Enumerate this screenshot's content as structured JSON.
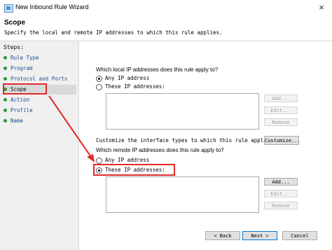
{
  "window": {
    "title": "New Inbound Rule Wizard",
    "close_glyph": "×"
  },
  "header": {
    "title": "Scope",
    "subtitle": "Specify the local and remote IP addresses to which this rule applies."
  },
  "steps": {
    "title": "Steps:",
    "items": [
      {
        "label": "Rule Type"
      },
      {
        "label": "Program"
      },
      {
        "label": "Protocol and Ports"
      },
      {
        "label": "Scope"
      },
      {
        "label": "Action"
      },
      {
        "label": "Profile"
      },
      {
        "label": "Name"
      }
    ],
    "active_index": 3
  },
  "local": {
    "question": "Which local IP addresses does this rule apply to?",
    "any_label": "Any IP address",
    "these_label": "These IP addresses:",
    "selected": "any",
    "add": "Add...",
    "edit": "Edit...",
    "remove": "Remove"
  },
  "customize": {
    "text": "Customize the interface types to which this rule applies:",
    "button": "Customize..."
  },
  "remote": {
    "question": "Which remote IP addresses does this rule apply to?",
    "any_label": "Any IP address",
    "these_label": "These IP addresses:",
    "selected": "these",
    "add": "Add...",
    "edit": "Edit...",
    "remove": "Remove"
  },
  "footer": {
    "back": "< Back",
    "next": "Next >",
    "cancel": "Cancel"
  },
  "colors": {
    "highlight": "#e02a2a",
    "step_dot": "#2e9b2e",
    "step_link": "#1a4f8f"
  }
}
